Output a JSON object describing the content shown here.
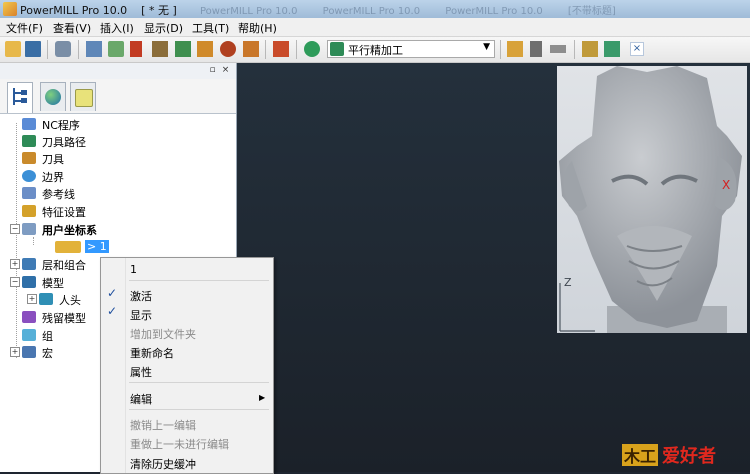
{
  "window": {
    "title": "PowerMILL Pro 10.0    [ * 无 ]",
    "background_tabs": [
      "PowerMILL Pro 10.0",
      "PowerMILL Pro 10.0",
      "PowerMILL Pro 10.0",
      "[不带标题]"
    ]
  },
  "menu": [
    "文件(F)",
    "查看(V)",
    "插入(I)",
    "显示(D)",
    "工具(T)",
    "帮助(H)"
  ],
  "toolbar": {
    "strategy_combo": "平行精加工",
    "icons": [
      "open-icon",
      "save-icon",
      "print-icon",
      "block-icon",
      "rapid-move-icon",
      "tool-icon",
      "feed-rate-icon",
      "leads-icon",
      "start-point-icon",
      "end-point-icon",
      "boundary-icon",
      "toolpath-calc-icon",
      "strategy-icon",
      "checker-icon",
      "calculator-icon",
      "ruler-icon",
      "measure-icon",
      "transform-icon"
    ]
  },
  "explorer": {
    "tabs": [
      "explorer-tab",
      "html-tab",
      "recycle-tab"
    ],
    "tree": [
      {
        "label": "NC程序",
        "icon": "nc-program-icon",
        "color": "#5a8bd6"
      },
      {
        "label": "刀具路径",
        "icon": "toolpath-icon",
        "color": "#2e8b57"
      },
      {
        "label": "刀具",
        "icon": "tool-icon",
        "color": "#c98a2b"
      },
      {
        "label": "边界",
        "icon": "boundary-icon",
        "color": "#3b8fd6"
      },
      {
        "label": "参考线",
        "icon": "pattern-icon",
        "color": "#6b8ec7"
      },
      {
        "label": "特征设置",
        "icon": "feature-icon",
        "color": "#d4a12a"
      },
      {
        "label": "用户坐标系",
        "icon": "workplane-icon",
        "color": "#7e9cc2"
      },
      {
        "label": "> 1",
        "icon": "workplane-item-icon",
        "color": "#e2b23a"
      },
      {
        "label": "层和组合",
        "icon": "levels-icon",
        "color": "#3f7bb5"
      },
      {
        "label": "模型",
        "icon": "models-icon",
        "color": "#2f6fa8"
      },
      {
        "label": "人头",
        "icon": "model-item-icon",
        "color": "#2f8fb5"
      },
      {
        "label": "残留模型",
        "icon": "stock-model-icon",
        "color": "#8a4fbf"
      },
      {
        "label": "组",
        "icon": "groups-icon",
        "color": "#56b0d8"
      },
      {
        "label": "宏",
        "icon": "macros-icon",
        "color": "#4a76b0"
      }
    ]
  },
  "context_menu": {
    "header": "1",
    "items": [
      {
        "label": "激活",
        "checked": true,
        "disabled": false
      },
      {
        "label": "显示",
        "checked": true,
        "disabled": false
      },
      {
        "label": "增加到文件夹",
        "checked": false,
        "disabled": true
      },
      {
        "label": "重新命名",
        "checked": false,
        "disabled": false
      },
      {
        "label": "属性",
        "checked": false,
        "disabled": false
      },
      {
        "label": "编辑",
        "checked": false,
        "disabled": false,
        "submenu": true
      },
      {
        "label": "撤销上一编辑",
        "checked": false,
        "disabled": true
      },
      {
        "label": "重做上一未进行编辑",
        "checked": false,
        "disabled": true
      },
      {
        "label": "清除历史缓冲",
        "checked": false,
        "disabled": false
      }
    ]
  },
  "viewport": {
    "axis_label_z": "Z",
    "axis_marker": "X"
  },
  "watermark": {
    "text": "木工爱好者"
  }
}
